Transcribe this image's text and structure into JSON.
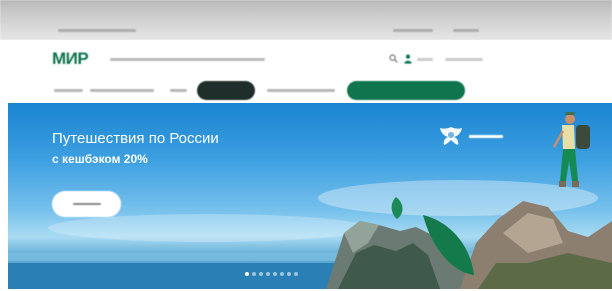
{
  "header": {
    "logo": "МИР",
    "accent_color": "#0f754e",
    "icons": [
      "search-icon",
      "user-icon"
    ]
  },
  "nav": {
    "pill_dark_color": "#1f2e2a",
    "pill_green_color": "#0f754e"
  },
  "banner": {
    "headline_line1": "Путешествия по России",
    "headline_line2": "с кешбэком 20%",
    "button_icon": "pill-button",
    "partner_emblem": "eagle-emblem-icon",
    "slides_total": 8,
    "slide_active_index": 0
  }
}
